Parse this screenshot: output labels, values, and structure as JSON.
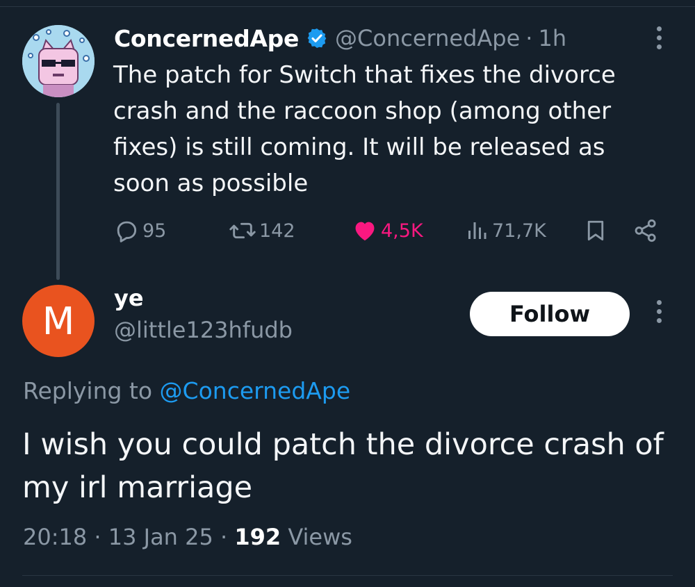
{
  "parent_tweet": {
    "author_name": "ConcernedApe",
    "author_handle": "@ConcernedApe",
    "separator": "·",
    "time_ago": "1h",
    "text": "The patch for Switch that fixes the divorce crash and the raccoon shop (among other fixes) is still coming. It will be released as soon as possible",
    "stats": {
      "replies": "95",
      "retweets": "142",
      "likes": "4,5K",
      "views": "71,7K"
    },
    "icons": [
      "verified-badge-icon",
      "more-options-icon",
      "reply-icon",
      "retweet-icon",
      "like-icon",
      "views-icon",
      "bookmark-icon",
      "share-icon"
    ]
  },
  "reply_tweet": {
    "avatar_letter": "M",
    "author_name": "ye",
    "author_handle": "@little123hfudb",
    "follow_label": "Follow",
    "replying_prefix": "Replying to",
    "replying_mention": "@ConcernedApe",
    "text": "I wish you could patch the divorce crash of my irl marriage",
    "time": "20:18",
    "date": "13 Jan 25",
    "separator": "·",
    "views_count": "192",
    "views_label": "Views"
  },
  "colors": {
    "background": "#15202b",
    "like": "#f91880",
    "link": "#1d9bf0",
    "muted": "#8b98a5",
    "avatar_m": "#e9531f",
    "verified": "#1d9bf0"
  }
}
